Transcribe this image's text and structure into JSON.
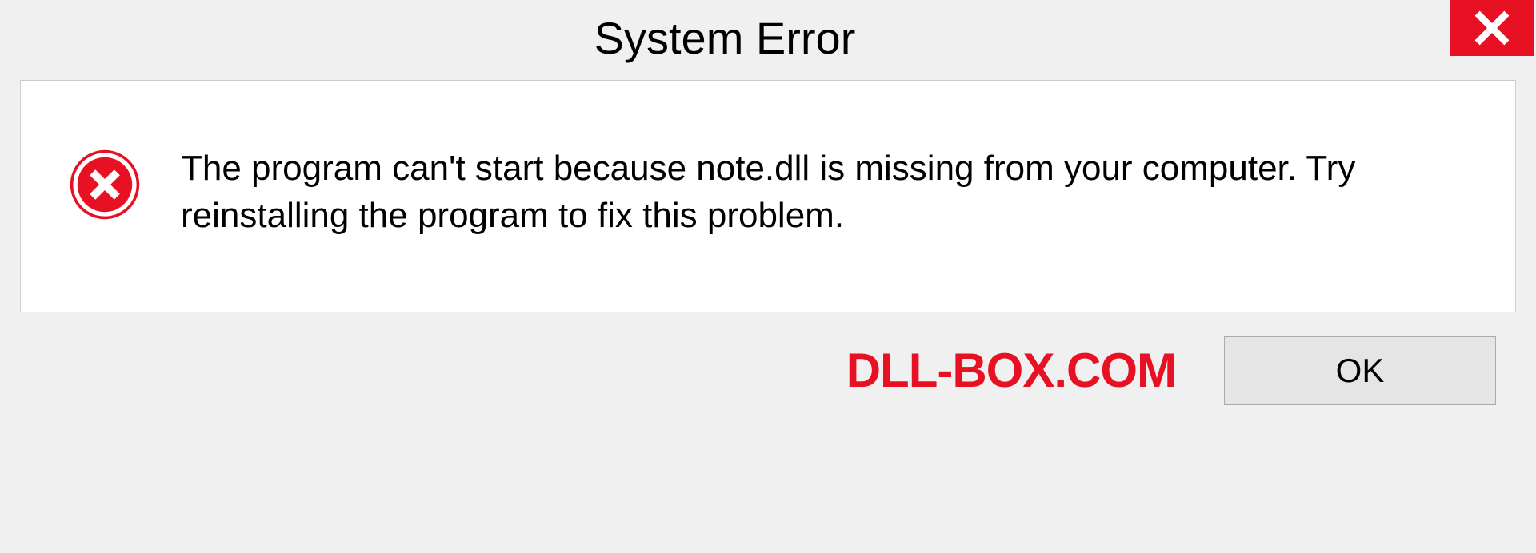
{
  "titlebar": {
    "title": "System Error"
  },
  "dialog": {
    "message": "The program can't start because note.dll is missing from your computer. Try reinstalling the program to fix this problem."
  },
  "footer": {
    "watermark": "DLL-BOX.COM",
    "ok_label": "OK"
  }
}
